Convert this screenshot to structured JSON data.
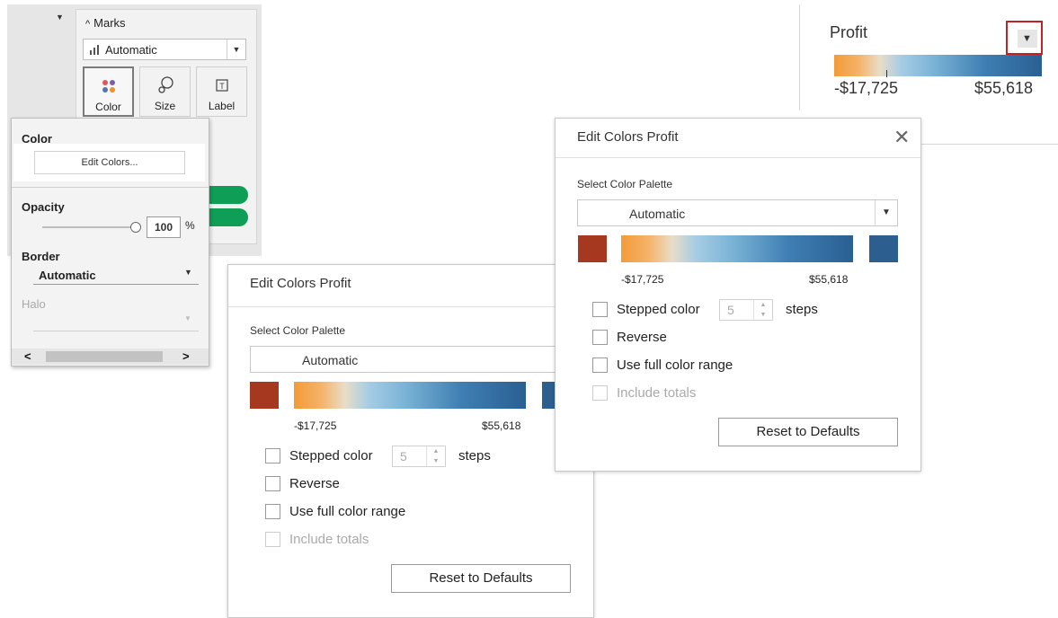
{
  "marks_panel": {
    "title": "Marks",
    "mark_type": "Automatic",
    "buttons": [
      {
        "label": "Color",
        "icon": "color-dots-icon"
      },
      {
        "label": "Size",
        "icon": "size-icon"
      },
      {
        "label": "Label",
        "icon": "text-label-icon"
      }
    ]
  },
  "color_popup": {
    "color_title": "Color",
    "edit_colors_label": "Edit Colors...",
    "opacity_title": "Opacity",
    "opacity_value": "100",
    "opacity_unit": "%",
    "border_title": "Border",
    "border_value": "Automatic",
    "halo_title": "Halo"
  },
  "edit_dialog_back": {
    "title": "Edit Colors Profit",
    "palette_label": "Select Color Palette",
    "palette_value": "Automatic",
    "range_min": "-$17,725",
    "range_max": "$55,618",
    "stepped_label": "Stepped color",
    "steps_value": "5",
    "steps_label": "steps",
    "reverse_label": "Reverse",
    "full_range_label": "Use full color range",
    "include_totals_label": "Include totals",
    "reset_label": "Reset to Defaults"
  },
  "edit_dialog_front": {
    "title": "Edit Colors Profit",
    "palette_label": "Select Color Palette",
    "palette_value": "Automatic",
    "range_min": "-$17,725",
    "range_max": "$55,618",
    "stepped_label": "Stepped color",
    "steps_value": "5",
    "steps_label": "steps",
    "reverse_label": "Reverse",
    "full_range_label": "Use full color range",
    "include_totals_label": "Include totals",
    "reset_label": "Reset to Defaults"
  },
  "profit_legend": {
    "title": "Profit",
    "min_label": "-$17,725",
    "max_label": "$55,618"
  },
  "colors": {
    "negative_swatch": "#a5381e",
    "positive_swatch": "#2c5e8f",
    "ramp_low": "#f39b37",
    "ramp_high": "#2a5f92",
    "highlight_outline": "#c42126",
    "pill_green": "#0e9e55"
  }
}
